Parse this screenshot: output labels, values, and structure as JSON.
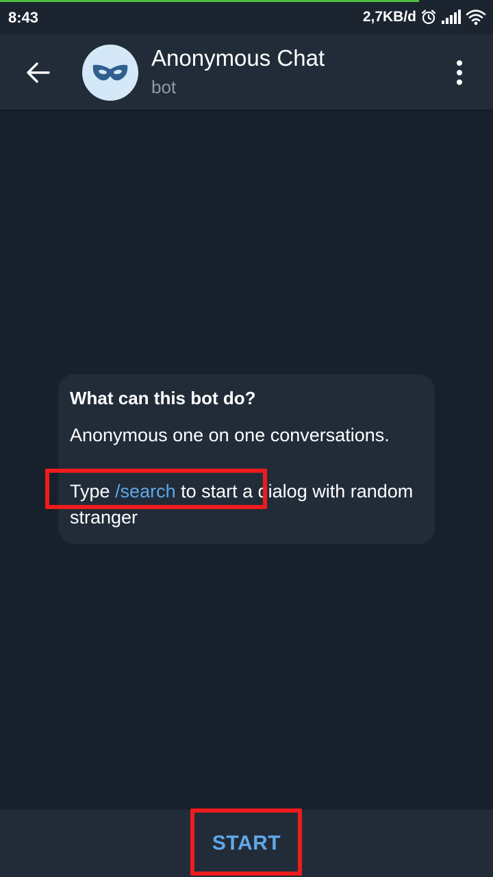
{
  "status_bar": {
    "time": "8:43",
    "network_speed": "2,7KB/d",
    "icons": [
      "alarm-icon",
      "signal-icon",
      "wifi-icon"
    ]
  },
  "header": {
    "back_icon": "arrow-left-icon",
    "avatar_icon": "mask-icon",
    "title": "Anonymous Chat",
    "subtitle": "bot",
    "menu_icon": "more-vertical-icon"
  },
  "info_card": {
    "title": "What can this bot do?",
    "line1": "Anonymous one on one conversations.",
    "line2_prefix": "Type ",
    "line2_command": "/search",
    "line2_suffix": " to start a dialog with random stranger"
  },
  "bottom": {
    "start_label": "START"
  },
  "colors": {
    "background": "#18202b",
    "header": "#222c39",
    "accent_link": "#5fa8e8",
    "highlight": "#ee1c1c",
    "avatar_bg": "#d5e8f8",
    "progress": "#4cbd3f"
  }
}
